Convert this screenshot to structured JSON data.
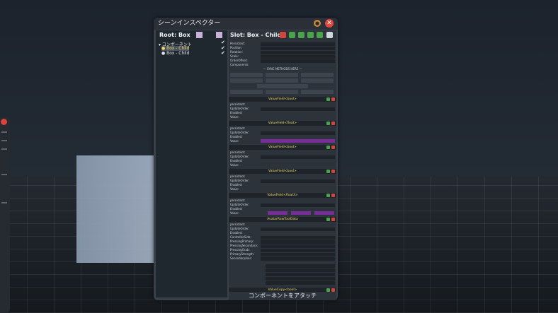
{
  "window": {
    "title": "シーンインスペクター"
  },
  "hierarchy": {
    "header": "Root: Box",
    "items": [
      {
        "label": "▾ コンポーネント",
        "checked": true
      },
      {
        "label": "● Box - Child",
        "checked": true
      },
      {
        "label": "● Box - Child",
        "checked": true
      }
    ]
  },
  "slot": {
    "header": "Slot: Box - Child",
    "fields": [
      {
        "key": "Persistent:"
      },
      {
        "key": "Position:"
      },
      {
        "key": "Rotation:"
      },
      {
        "key": "Scale:"
      },
      {
        "key": "OrderOffset:"
      },
      {
        "key": "Components:"
      }
    ],
    "sync_methods": "--- SYNC METHODS HERE ---",
    "components": [
      {
        "title": "ValueField<bool>",
        "fields": [
          "persistent:",
          "UpdateOrder:",
          "Enabled:",
          "Value:"
        ]
      },
      {
        "title": "ValueField<float>",
        "fields": [
          "persistent:",
          "UpdateOrder:",
          "Enabled:",
          "Value:"
        ]
      },
      {
        "title": "ValueField<bool>",
        "fields": [
          "persistent:",
          "UpdateOrder:",
          "Enabled:",
          "Value:"
        ]
      },
      {
        "title": "ValueField<bool>",
        "fields": [
          "persistent:",
          "UpdateOrder:",
          "Enabled:",
          "Value:"
        ]
      },
      {
        "title": "ValueField<float3>",
        "fields": [
          "persistent:",
          "UpdateOrder:",
          "Enabled:",
          "Value:"
        ]
      },
      {
        "title": "AvatarRawToolData",
        "fields": [
          "persistent:",
          "UpdateOrder:",
          "Enabled:",
          "ControllerSide:",
          "PressingPrimary:",
          "PressingSecondary:",
          "PressingGrab:",
          "PrimaryStrength:",
          "SecondaryAxis:"
        ]
      },
      {
        "title": "ValueCopy<bool>",
        "fields": []
      }
    ]
  },
  "attach_button": "コンポーネントをアタッチ"
}
